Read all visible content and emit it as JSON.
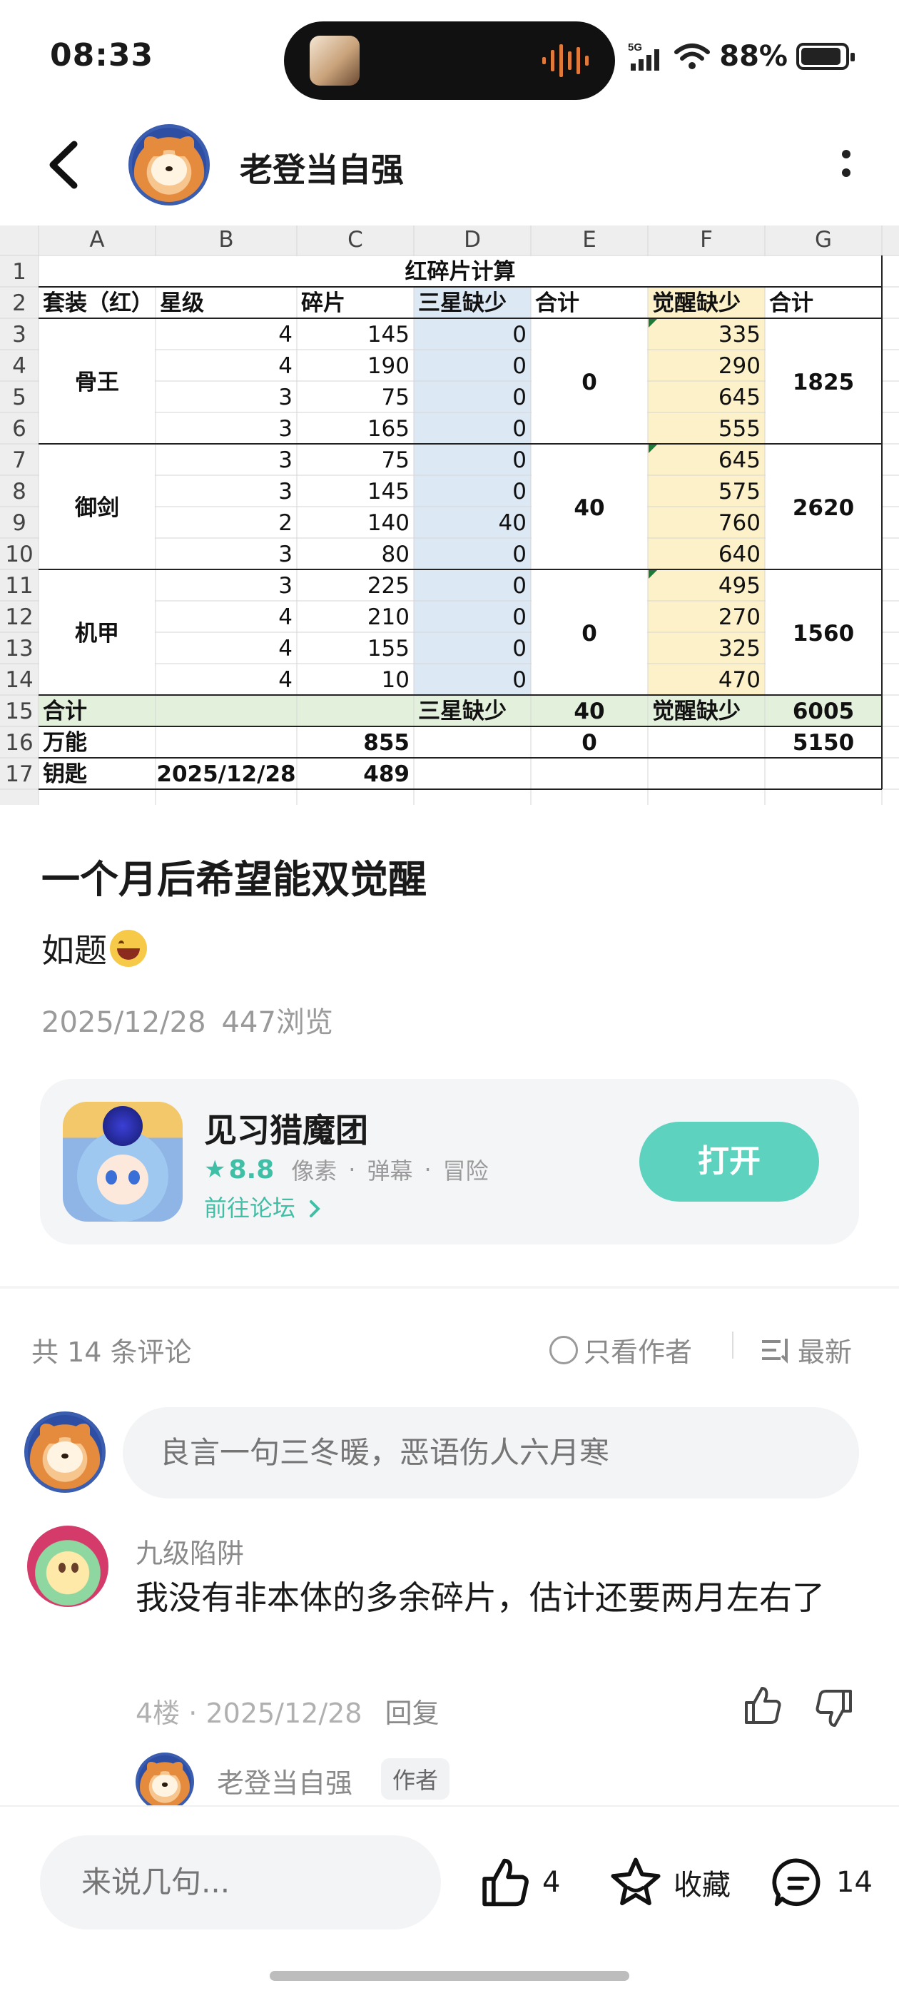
{
  "status_bar": {
    "time": "08:33",
    "network": "5G",
    "battery": "88%",
    "battery_level": 0.88
  },
  "header": {
    "title": "老登当自强"
  },
  "sheet": {
    "col_headers": [
      "A",
      "B",
      "C",
      "D",
      "E",
      "F",
      "G"
    ],
    "row_headers": [
      "1",
      "2",
      "3",
      "4",
      "5",
      "6",
      "7",
      "8",
      "9",
      "10",
      "11",
      "12",
      "13",
      "14",
      "15",
      "16",
      "17"
    ],
    "title": "红碎片计算",
    "headers": [
      "套装（红）",
      "星级",
      "碎片",
      "三星缺少",
      "合计",
      "觉醒缺少",
      "合计"
    ],
    "groups": [
      {
        "name": "骨王",
        "rows": [
          [
            4,
            145,
            0,
            335
          ],
          [
            4,
            190,
            0,
            290
          ],
          [
            3,
            75,
            0,
            645
          ],
          [
            3,
            165,
            0,
            555
          ]
        ],
        "total_three_star": "0",
        "total_awaken": "1825"
      },
      {
        "name": "御剑",
        "rows": [
          [
            3,
            75,
            0,
            645
          ],
          [
            3,
            145,
            0,
            575
          ],
          [
            2,
            140,
            40,
            760
          ],
          [
            3,
            80,
            0,
            640
          ]
        ],
        "total_three_star": "40",
        "total_awaken": "2620"
      },
      {
        "name": "机甲",
        "rows": [
          [
            3,
            225,
            0,
            495
          ],
          [
            4,
            210,
            0,
            270
          ],
          [
            4,
            155,
            0,
            325
          ],
          [
            4,
            10,
            0,
            470
          ]
        ],
        "total_three_star": "0",
        "total_awaken": "1560"
      }
    ],
    "total_row": {
      "label": "合计",
      "three_star_label": "三星缺少",
      "three_star_value": "40",
      "awaken_label": "觉醒缺少",
      "awaken_value": "6005"
    },
    "universal_row": {
      "label": "万能",
      "shards": "855",
      "three_star": "0",
      "awaken": "5150"
    },
    "key_row": {
      "label": "钥匙",
      "date": "2025/12/28",
      "shards": "489"
    },
    "colors": {
      "blue_col": "#dde8f5",
      "yellow_col": "#fcf1c9",
      "total_row": "#e3f0dc",
      "header_bg": "#eeeeee",
      "flag": "#1f7a3a"
    }
  },
  "post": {
    "title": "一个月后希望能双觉醒",
    "body": "如题",
    "date": "2025/12/28",
    "views": "447浏览"
  },
  "app_card": {
    "name": "见习猎魔团",
    "rating": "8.8",
    "tags": [
      "像素",
      "弹幕",
      "冒险"
    ],
    "tag_separator": "·",
    "forum_link": "前往论坛",
    "open_label": "打开"
  },
  "comments_header": {
    "count_label": "共 14 条评论",
    "author_only_label": "只看作者",
    "sort_label": "最新"
  },
  "comment_input": {
    "placeholder": "良言一句三冬暖，恶语伤人六月寒"
  },
  "comments": [
    {
      "user": "九级陷阱",
      "text": "我没有非本体的多余碎片，估计还要两月左右了",
      "floor": "4楼",
      "date": "2025/12/28",
      "reply_label": "回复",
      "reply_preview": {
        "user": "老登当自强",
        "badge": "作者"
      }
    }
  ],
  "bottom_bar": {
    "input_placeholder": "来说几句...",
    "like_count": "4",
    "favorite_label": "收藏",
    "comment_count": "14"
  }
}
